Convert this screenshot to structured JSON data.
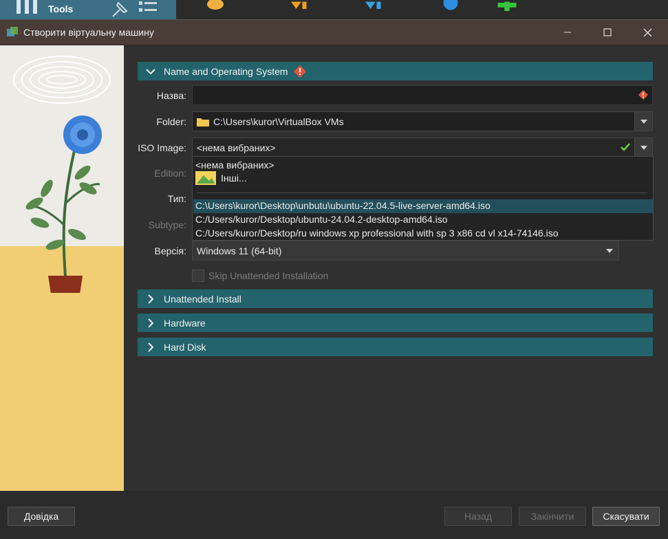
{
  "background_app": {
    "tools_label": "Tools"
  },
  "window": {
    "title": "Створити віртуальну машину",
    "minimize_icon": "minimize-icon",
    "maximize_icon": "maximize-icon",
    "close_icon": "close-icon"
  },
  "sections": {
    "name_os": {
      "label": "Name and Operating System",
      "expanded": true,
      "warning_icon": "warning-icon"
    },
    "unattended": {
      "label": "Unattended Install",
      "expanded": false
    },
    "hardware": {
      "label": "Hardware",
      "expanded": false
    },
    "hard_disk": {
      "label": "Hard Disk",
      "expanded": false
    }
  },
  "form": {
    "name_label": "Назва:",
    "name_value": "",
    "folder_label": "Folder:",
    "folder_value": "C:\\Users\\kuror\\VirtualBox VMs",
    "iso_label": "ISO Image:",
    "iso_value": "<нема вибраних>",
    "edition_label": "Edition:",
    "type_label": "Тип:",
    "subtype_label": "Subtype:",
    "version_label": "Версія:",
    "version_value": "Windows 11 (64-bit)",
    "skip_unattended_label": "Skip Unattended Installation",
    "skip_unattended_checked": false
  },
  "iso_popup": {
    "items": [
      "<нема вибраних>",
      "Інші...",
      "C:\\Users\\kuror\\Desktop\\unbutu\\ubuntu-22.04.5-live-server-amd64.iso",
      "C:/Users/kuror/Desktop/ubuntu-24.04.2-desktop-amd64.iso",
      "C:/Users/kuror/Desktop/ru windows xp professional with sp 3 x86 cd vl x14-74146.iso"
    ],
    "selected_index": 2
  },
  "footer": {
    "help": "Довідка",
    "back": "Назад",
    "finish": "Закінчити",
    "cancel": "Скасувати"
  },
  "colors": {
    "section_bg": "#23636c",
    "titlebar_bg": "#4a3c36",
    "accent_selection": "#234f5c"
  }
}
